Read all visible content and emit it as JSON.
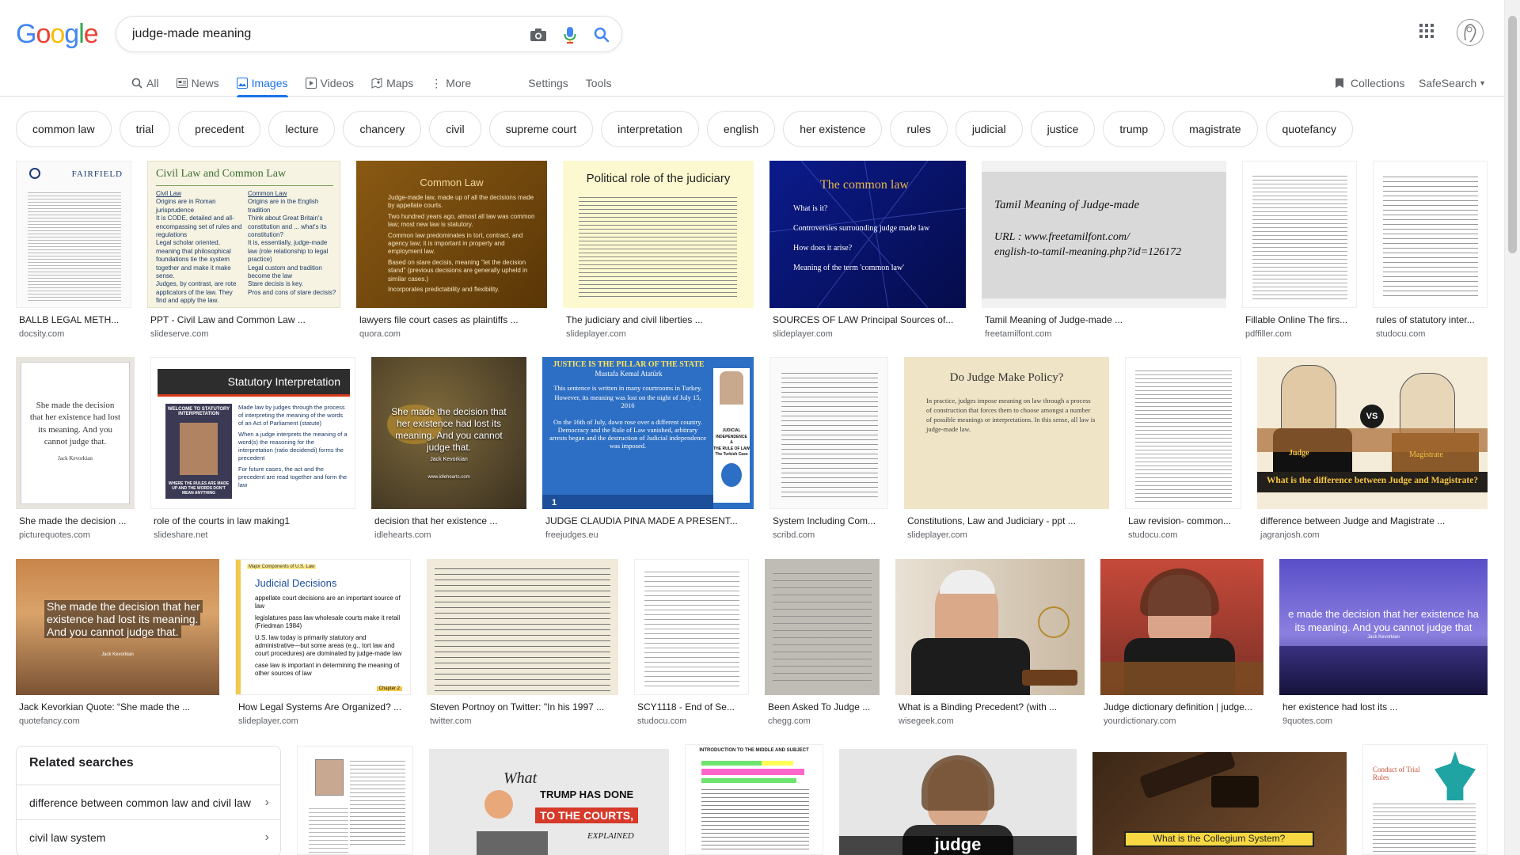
{
  "logo": {
    "text": "Google",
    "colors": [
      "#4285F4",
      "#EA4335",
      "#FBBC05",
      "#4285F4",
      "#34A853",
      "#EA4335"
    ]
  },
  "search": {
    "query": "judge-made meaning"
  },
  "tabs": [
    {
      "label": "All",
      "icon": "search-icon"
    },
    {
      "label": "News",
      "icon": "news-icon"
    },
    {
      "label": "Images",
      "icon": "image-icon",
      "active": true
    },
    {
      "label": "Videos",
      "icon": "video-icon"
    },
    {
      "label": "Maps",
      "icon": "map-icon"
    },
    {
      "label": "More",
      "icon": "more-vertical-icon"
    }
  ],
  "tools": {
    "settings": "Settings",
    "tools": "Tools",
    "collections": "Collections",
    "safesearch": "SafeSearch"
  },
  "chips": [
    "common law",
    "trial",
    "precedent",
    "lecture",
    "chancery",
    "civil",
    "supreme court",
    "interpretation",
    "english",
    "her existence",
    "rules",
    "judicial",
    "justice",
    "trump",
    "magistrate",
    "quotefancy"
  ],
  "results": [
    {
      "title": "BALLB LEGAL METH...",
      "source": "docsity.com",
      "thumb_text": "FAIRFIELD"
    },
    {
      "title": "PPT - Civil Law and Common Law ...",
      "source": "slideserve.com",
      "thumb_text": "Civil Law and Common Law",
      "thumb_col1_head": "Civil Law",
      "thumb_col1": [
        "Origins are in Roman jurisprudence",
        "It is CODE, detailed and all-encompassing set of rules and regulations",
        "Legal scholar oriented, meaning that philosophical foundations tie the system together and make it make sense.",
        "Judges, by contrast, are rote applicators of the law. They find and apply the law."
      ],
      "thumb_col2_head": "Common Law",
      "thumb_col2": [
        "Origins are in the English tradition",
        "Think about Great Britain's constitution and ... what's its constitution?",
        "It is, essentially, judge-made law (role relationship to legal practice)",
        "Legal custom and tradition become the law",
        "Stare decisis is key.",
        "Pros and cons of stare decisis?"
      ]
    },
    {
      "title": "lawyers file court cases as plaintiffs ...",
      "source": "quora.com",
      "thumb_text": "Common Law",
      "thumb_lines": [
        "Judge-made law, made up of all the decisions made by appellate courts.",
        "Two hundred years ago, almost all law was common law; most new law is statutory.",
        "Common law predominates in tort, contract, and agency law; it is important in property and employment law.",
        "Based on stare decisis, meaning \"let the decision stand\" (previous decisions are generally upheld in similar cases.)",
        "Incorporates predictability and flexibility."
      ]
    },
    {
      "title": "The judiciary and civil liberties ...",
      "source": "slideplayer.com",
      "thumb_text": "Political role of the judiciary"
    },
    {
      "title": "SOURCES OF LAW Principal Sources of...",
      "source": "slideplayer.com",
      "thumb_text": "The common law",
      "thumb_lines": [
        "What is it?",
        "Controversies surrounding judge made law",
        "How does it arise?",
        "Meaning of the term 'common law'"
      ]
    },
    {
      "title": "Tamil Meaning of Judge-made ...",
      "source": "freetamilfont.com",
      "thumb_text": "Tamil Meaning of Judge-made",
      "thumb_lines": [
        "URL : www.freetamilfont.com/",
        "english-to-tamil-meaning.php?id=126172"
      ]
    },
    {
      "title": "Fillable Online The firs...",
      "source": "pdffiller.com"
    },
    {
      "title": "rules of statutory inter...",
      "source": "studocu.com"
    },
    {
      "title": "She made the decision ...",
      "source": "picturequotes.com",
      "thumb_lines": [
        "She made the decision",
        "that her existence had lost",
        "its meaning. And you",
        "cannot judge that."
      ],
      "thumb_sub": "Jack Kevorkian"
    },
    {
      "title": "role of the courts in law making1",
      "source": "slideshare.net",
      "thumb_text": "Statutory Interpretation",
      "thumb_lines": [
        "Made law by judges through the process of interpreting the meaning of the words of an Act of Parliament (statute)",
        "When a judge interprets the meaning of a word(s) the reasoning for the interpretation (ratio decidendi) forms the precedent",
        "For future cases, the act and the precedent are read together and form the law"
      ],
      "thumb_sub": "WELCOME TO STATUTORY INTERPRETATION",
      "thumb_sub2": "WHERE THE RULES ARE MADE UP AND THE WORDS DON'T MEAN ANYTHING"
    },
    {
      "title": "decision that her existence ...",
      "source": "idlehearts.com",
      "thumb_lines": [
        "She made the decision that",
        "her existence had lost its",
        "meaning. And you cannot",
        "judge that."
      ],
      "thumb_sub": "Jack Kevorkian",
      "thumb_sub2": "www.idlehearts.com"
    },
    {
      "title": "JUDGE CLAUDIA PINA MADE A PRESENT...",
      "source": "freejudges.eu",
      "thumb_text": "JUSTICE IS THE PILLAR OF THE STATE",
      "thumb_sub": "Mustafa Kemal Atatürk",
      "thumb_lines": [
        "This sentence is written in many courtrooms in Turkey.",
        "However, its meaning was lost on the night of July 15, 2016",
        "On the 16th of July, dawn rose over a different country. Democracy and the Rule of Law vanished, arbitrary arrests began and the destruction of Judicial independence was imposed."
      ],
      "thumb_side": [
        "JUDICIAL",
        "INDEPENDENCE",
        "&",
        "THE RULE OF LAW",
        "The Turkish Case"
      ],
      "thumb_num": "1"
    },
    {
      "title": "System Including Com...",
      "source": "scribd.com"
    },
    {
      "title": "Constitutions, Law and Judiciary - ppt ...",
      "source": "slideplayer.com",
      "thumb_text": "Do Judge Make Policy?",
      "thumb_lines": [
        "In practice, judges impose meaning on law through a process of construction that forces them to choose amongst a number of possible meanings or interpretations. In this sense, all law is judge-made law."
      ]
    },
    {
      "title": "Law revision- common...",
      "source": "studocu.com"
    },
    {
      "title": "difference between Judge and Magistrate ...",
      "source": "jagranjosh.com",
      "thumb_text": "What is the difference between Judge and Magistrate?",
      "thumb_sub": "Judge",
      "thumb_sub2": "Magistrate",
      "thumb_vs": "VS"
    },
    {
      "title": "Jack Kevorkian Quote: “She made the ...",
      "source": "quotefancy.com",
      "thumb_lines": [
        "She made the decision that her",
        "existence had lost its meaning.",
        "And you cannot judge that."
      ],
      "thumb_sub": "Jack Kevorkian"
    },
    {
      "title": "How Legal Systems Are Organized? ...",
      "source": "slideplayer.com",
      "thumb_text": "Judicial Decisions",
      "thumb_sub": "Major Components of U.S. Law",
      "thumb_lines": [
        "appellate court decisions are an important source of law",
        "legislatures pass law wholesale courts make it retail (Friedman 1984)",
        "U.S. law today is primarily statutory and administrative—but some areas (e.g., tort law and court procedures) are dominated by judge-made law",
        "case law is important in determining the meaning of other sources of law"
      ],
      "thumb_sub2": "Chapter 2"
    },
    {
      "title": "Steven Portnoy on Twitter: \"In his 1997 ...",
      "source": "twitter.com"
    },
    {
      "title": "SCY1118 - End of Se...",
      "source": "studocu.com"
    },
    {
      "title": "Been Asked To Judge ...",
      "source": "chegg.com"
    },
    {
      "title": "What is a Binding Precedent? (with ...",
      "source": "wisegeek.com"
    },
    {
      "title": "Judge dictionary definition | judge...",
      "source": "yourdictionary.com"
    },
    {
      "title": "her existence had lost its ...",
      "source": "9quotes.com",
      "thumb_lines": [
        "e made the decision that her existence ha",
        "its meaning. And you cannot judge that"
      ],
      "thumb_sub": "Jack Kevorkian"
    }
  ],
  "bottom_thumbs": [
    {
      "name": "what-is-common-law"
    },
    {
      "name": "trump-courts",
      "text1": "What",
      "text2": "TRUMP HAS DONE",
      "text3": "TO THE COURTS,",
      "text4": "EXPLAINED"
    },
    {
      "name": "intro-middle-subject",
      "text1": "INTRODUCTION TO THE MIDDLE AND SUBJECT"
    },
    {
      "name": "judge-video",
      "text1": "judge"
    },
    {
      "name": "collegium",
      "text1": "What is the Collegium System?"
    },
    {
      "name": "trial-rules",
      "text1": "Conduct of Trial Rules"
    }
  ],
  "related": {
    "title": "Related searches",
    "items": [
      "difference between common law and civil law",
      "civil law system"
    ]
  }
}
